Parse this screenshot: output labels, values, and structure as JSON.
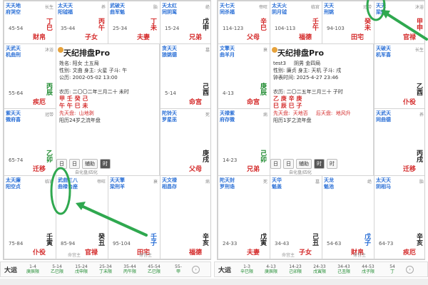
{
  "left": {
    "cells": [
      {
        "stars": "天天地\n府哭空",
        "range": "45-54",
        "palace": "财帛",
        "gz": "丁巳",
        "gz_color": "red",
        "side": "长生"
      },
      {
        "stars": "太天天\n阳钺福",
        "range": "35-44",
        "palace": "子女",
        "gz": "丙午",
        "gz_color": "red",
        "side": "养"
      },
      {
        "stars": "武破天\n曲军魁",
        "range": "25-34",
        "palace": "夫妻",
        "gz": "丁未",
        "gz_color": "red",
        "side": "胎"
      },
      {
        "stars": "天太红\n同阴鸾",
        "range": "15-24",
        "palace": "兄弟",
        "gz": "戊申",
        "gz_color": "dark",
        "side": "绝"
      },
      {
        "stars": "天武天\n机曲刑",
        "range": "55-64",
        "palace": "疾厄",
        "gz": "丙辰",
        "gz_color": "green",
        "side": "沐浴"
      },
      {
        "stars": "贪天天\n狼姚德",
        "range": "5-14",
        "palace": "命宫",
        "gz": "己酉",
        "gz_color": "dark",
        "side": "墓"
      },
      {
        "stars": "紫天天\n微府喜",
        "range": "65-74",
        "palace": "迁移",
        "gz": "乙卯",
        "gz_color": "green",
        "side": "冠带"
      },
      {
        "stars": "陀铃天\n罗星巫",
        "range": "",
        "palace": "父母",
        "gz": "庚戌",
        "gz_color": "dark",
        "side": "死"
      },
      {
        "stars": "太天廉\n阳空贞",
        "range": "75-84",
        "palace": "仆役",
        "gz": "壬寅",
        "gz_color": "dark",
        "side": "临官"
      },
      {
        "stars": "武曲三八\n曲禄台座",
        "range": "85-94",
        "palace": "官禄",
        "gz": "癸丑",
        "gz_color": "dark",
        "side": "帝旺"
      },
      {
        "stars": "天天擎\n梁刑羊",
        "range": "95-104",
        "palace": "田宅",
        "gz": "壬子",
        "gz_color": "blue",
        "side": "衰"
      },
      {
        "stars": "天文禄\n相昌存",
        "range": "",
        "palace": "福德",
        "gz": "辛亥",
        "gz_color": "dark",
        "side": "病"
      }
    ],
    "center": {
      "title": "天纪排盘Pro",
      "info": "姓名: 阳女 土五局\n性别: 文曲 身主: 火星 子斗: 午\n公历: 2002-05-02 13:00",
      "lines": [
        "农历: 二〇〇二年三月二十 未时",
        "甲 壬 癸 己",
        "午 午 巳 未",
        "先天盘:  山地剥",
        "阳历24岁之流年盘"
      ]
    },
    "toolbar": [
      "日",
      "日",
      "辅助",
      "时"
    ],
    "toolbar_hint": "自化盘/四化",
    "dayun": {
      "title": "大运",
      "items": [
        [
          "1-4",
          "庚辰限"
        ],
        [
          "5-14",
          "乙巳限"
        ],
        [
          "15-24",
          "戊申限"
        ],
        [
          "25-34",
          "丁未限"
        ],
        [
          "35-44",
          "丙午限"
        ],
        [
          "45-54",
          "乙巳限"
        ],
        [
          "55-",
          "甲"
        ]
      ]
    },
    "bottom_labels": [
      "命宫主",
      "身宫主"
    ]
  },
  "right": {
    "cells": [
      {
        "stars": "天七天\n同杀福",
        "range": "114-123",
        "palace": "父母",
        "gz": "辛巳",
        "gz_color": "red",
        "side": "帝旺"
      },
      {
        "stars": "太天火\n阴月钺",
        "range": "104-113",
        "palace": "福德",
        "gz": "壬午",
        "gz_color": "red",
        "side": "临官"
      },
      {
        "stars": "天天\n刑姚",
        "range": "94-103",
        "palace": "田宅",
        "gz": "癸未",
        "gz_color": "red",
        "side": "冠带"
      },
      {
        "stars": "天天\n梁魁",
        "range": "",
        "palace": "官禄",
        "gz": "甲申",
        "gz_color": "red",
        "side": "沐浴"
      },
      {
        "stars": "文擎天\n曲羊月",
        "range": "4-13",
        "palace": "命宫",
        "gz": "庚辰",
        "gz_color": "green",
        "side": "衰"
      },
      {
        "stars": "天破天\n机军喜",
        "range": "",
        "palace": "仆役",
        "gz": "乙酉",
        "gz_color": "dark",
        "side": "长生"
      },
      {
        "stars": "天禄紫\n府存微",
        "range": "14-23",
        "palace": "兄弟",
        "gz": "己卯",
        "gz_color": "green",
        "side": "病"
      },
      {
        "stars": "天武天\n同曲德",
        "range": "",
        "palace": "迁移",
        "gz": "丙戌",
        "gz_color": "dark",
        "side": "养"
      },
      {
        "stars": "陀天封\n罗刑诰",
        "range": "24-33",
        "palace": "夫妻",
        "gz": "戊寅",
        "gz_color": "dark",
        "side": "死"
      },
      {
        "stars": "天华\n魁盖",
        "range": "34-43",
        "palace": "子女",
        "gz": "己丑",
        "gz_color": "dark",
        "side": "墓"
      },
      {
        "stars": "天龙\n魁池",
        "range": "54-63",
        "palace": "财帛",
        "gz": "戊子",
        "gz_color": "blue",
        "side": "绝"
      },
      {
        "stars": "太天天\n阴相马",
        "range": "64-73",
        "palace": "疾厄",
        "gz": "辛亥",
        "gz_color": "dark",
        "side": "胎"
      }
    ],
    "center": {
      "title": "天纪排盘Pro",
      "info": "test3     阴男 金四局\n性别: 廉贞 身主: 天机 子斗: 戌\n钟表时间: 2025-4-27 23:46",
      "lines": [
        "农历: 二〇二五年三月三十 子时",
        "乙 庚 辛 庚",
        "巳 辰 巳 子",
        "先天盘:  天地否     后天盘:  地风升",
        "阳历1岁之流年盘"
      ]
    },
    "toolbar": [
      "日",
      "日",
      "辅助",
      "时",
      "时"
    ],
    "toolbar_hint": "自化盘/四化",
    "dayun": {
      "title": "大运",
      "items": [
        [
          "1-3",
          "辛巳限"
        ],
        [
          "4-13",
          "庚辰限"
        ],
        [
          "14-23",
          "己卯限"
        ],
        [
          "24-33",
          "戊寅限"
        ],
        [
          "34-43",
          "己丑限"
        ],
        [
          "44-53",
          "戊子限"
        ],
        [
          "54",
          "丁"
        ]
      ]
    },
    "bottom_labels": [
      "命宫主",
      "身宫主"
    ]
  }
}
